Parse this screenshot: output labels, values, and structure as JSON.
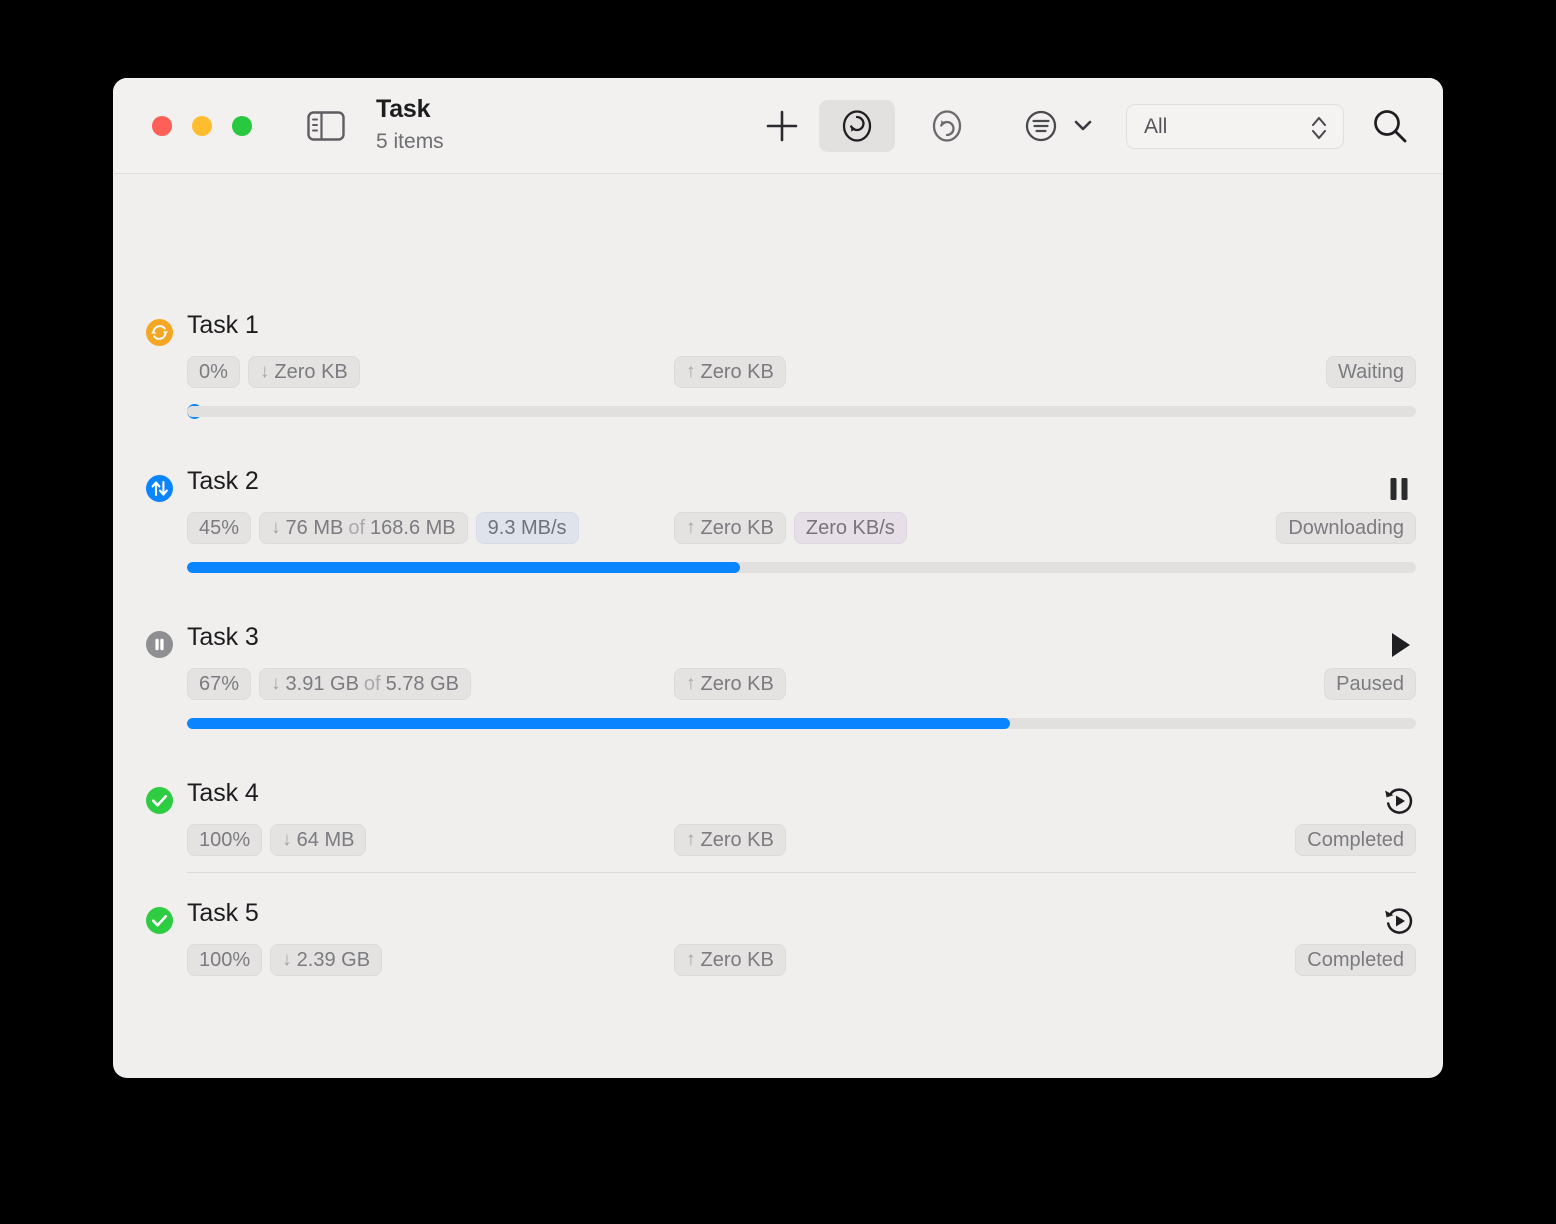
{
  "window": {
    "title": "Task",
    "subtitle": "5 items",
    "traffic_lights": {
      "close_label": "Close",
      "minimize_label": "Minimize",
      "maximize_label": "Maximize",
      "close_color": "#ff5f57",
      "minimize_color": "#febc2e",
      "maximize_color": "#28c840"
    }
  },
  "toolbar": {
    "sidebar_toggle_name": "sidebar-toggle-icon",
    "add_label": "+",
    "download_filter_label": "Downloads",
    "upload_filter_label": "Uploads",
    "sort_label": "Sort",
    "filter_value": "All",
    "search_label": "Search",
    "active_toggle": "download"
  },
  "colors": {
    "accent_blue": "#0a84ff",
    "waiting_orange": "#f5a623",
    "completed_green": "#2ecc40",
    "paused_gray": "#8e8e93",
    "badge_bg": "#e4e3e2",
    "speed_down_bg": "#dfe4ec",
    "speed_up_bg": "#e7dfe8",
    "window_bg": "#f0efee"
  },
  "tasks": [
    {
      "name": "Task 1",
      "icon": "sync-arrows-icon",
      "icon_color": "#f5a623",
      "percent_label": "0%",
      "progress": 0,
      "download_arrow": "↓",
      "download_text": "Zero KB",
      "download_of": "",
      "download_total": "",
      "download_speed": "",
      "upload_arrow": "↑",
      "upload_text": "Zero KB",
      "upload_speed": "",
      "status": "Waiting",
      "action": "none",
      "has_progress_bar": true,
      "divider_below": false
    },
    {
      "name": "Task 2",
      "icon": "up-down-arrows-icon",
      "icon_color": "#0a84ff",
      "percent_label": "45%",
      "progress": 45,
      "download_arrow": "↓",
      "download_text": "76 MB",
      "download_of": "of",
      "download_total": "168.6 MB",
      "download_speed": "9.3 MB/s",
      "upload_arrow": "↑",
      "upload_text": "Zero KB",
      "upload_speed": "Zero KB/s",
      "status": "Downloading",
      "action": "pause",
      "has_progress_bar": true,
      "divider_below": false
    },
    {
      "name": "Task 3",
      "icon": "pause-circle-icon",
      "icon_color": "#8e8e93",
      "percent_label": "67%",
      "progress": 67,
      "download_arrow": "↓",
      "download_text": "3.91 GB",
      "download_of": "of",
      "download_total": "5.78 GB",
      "download_speed": "",
      "upload_arrow": "↑",
      "upload_text": "Zero KB",
      "upload_speed": "",
      "status": "Paused",
      "action": "play",
      "has_progress_bar": true,
      "divider_below": false
    },
    {
      "name": "Task 4",
      "icon": "check-circle-icon",
      "icon_color": "#2ecc40",
      "percent_label": "100%",
      "progress": 100,
      "download_arrow": "↓",
      "download_text": "64 MB",
      "download_of": "",
      "download_total": "",
      "download_speed": "",
      "upload_arrow": "↑",
      "upload_text": "Zero KB",
      "upload_speed": "",
      "status": "Completed",
      "action": "restart",
      "has_progress_bar": false,
      "divider_below": true
    },
    {
      "name": "Task 5",
      "icon": "check-circle-icon",
      "icon_color": "#2ecc40",
      "percent_label": "100%",
      "progress": 100,
      "download_arrow": "↓",
      "download_text": "2.39 GB",
      "download_of": "",
      "download_total": "",
      "download_speed": "",
      "upload_arrow": "↑",
      "upload_text": "Zero KB",
      "upload_speed": "",
      "status": "Completed",
      "action": "restart",
      "has_progress_bar": false,
      "divider_below": false
    }
  ]
}
